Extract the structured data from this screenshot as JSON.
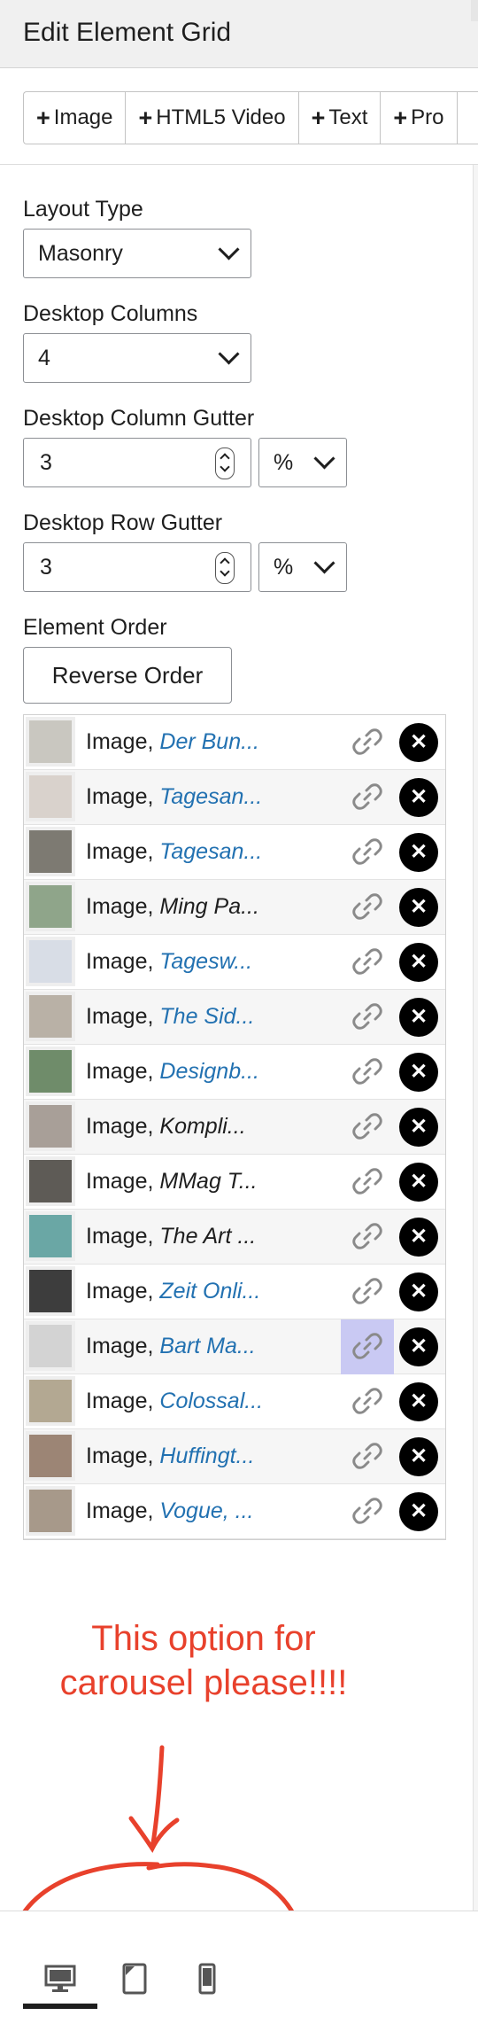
{
  "header": {
    "title": "Edit Element Grid"
  },
  "toolbar": {
    "buttons": [
      {
        "label": "Image"
      },
      {
        "label": "HTML5 Video"
      },
      {
        "label": "Text"
      },
      {
        "label": "Pro"
      }
    ]
  },
  "fields": {
    "layout_type": {
      "label": "Layout Type",
      "value": "Masonry"
    },
    "desktop_columns": {
      "label": "Desktop Columns",
      "value": "4"
    },
    "column_gutter": {
      "label": "Desktop Column Gutter",
      "value": "3",
      "unit": "%"
    },
    "row_gutter": {
      "label": "Desktop Row Gutter",
      "value": "3",
      "unit": "%"
    },
    "element_order": {
      "label": "Element Order",
      "button": "Reverse Order"
    }
  },
  "elements": [
    {
      "kind": "Image,",
      "name": "Der Bun...",
      "style": "link",
      "thumb": "#c9c7c0"
    },
    {
      "kind": "Image,",
      "name": "Tagesan...",
      "style": "link",
      "thumb": "#d9d2cc"
    },
    {
      "kind": "Image,",
      "name": "Tagesan...",
      "style": "link",
      "thumb": "#7d7a72"
    },
    {
      "kind": "Image,",
      "name": "Ming Pa...",
      "style": "plain",
      "thumb": "#8fa58a"
    },
    {
      "kind": "Image,",
      "name": "Tagesw...",
      "style": "link",
      "thumb": "#d8dde6"
    },
    {
      "kind": "Image,",
      "name": "The Sid...",
      "style": "link",
      "thumb": "#b9b1a6"
    },
    {
      "kind": "Image,",
      "name": "Designb...",
      "style": "link",
      "thumb": "#6f8c6a"
    },
    {
      "kind": "Image,",
      "name": "Kompli...",
      "style": "plain",
      "thumb": "#a89f98"
    },
    {
      "kind": "Image,",
      "name": "MMag T...",
      "style": "plain",
      "thumb": "#5e5b56"
    },
    {
      "kind": "Image,",
      "name": "The Art ...",
      "style": "plain",
      "thumb": "#6aa7a5"
    },
    {
      "kind": "Image,",
      "name": "Zeit Onli...",
      "style": "link",
      "thumb": "#3d3d3d"
    },
    {
      "kind": "Image,",
      "name": "Bart Ma...",
      "style": "link",
      "thumb": "#d3d3d3",
      "active": true
    },
    {
      "kind": "Image,",
      "name": "Colossal...",
      "style": "link",
      "thumb": "#b3a892"
    },
    {
      "kind": "Image,",
      "name": "Huffingt...",
      "style": "link",
      "thumb": "#9c8575"
    },
    {
      "kind": "Image,",
      "name": "Vogue, ...",
      "style": "link",
      "thumb": "#a7998a"
    }
  ],
  "annotation": {
    "text": "This option for carousel please!!!!",
    "color": "#e8412c"
  },
  "footer": {
    "devices": [
      "desktop-icon",
      "tablet-icon",
      "mobile-icon"
    ],
    "active": "desktop-icon"
  }
}
